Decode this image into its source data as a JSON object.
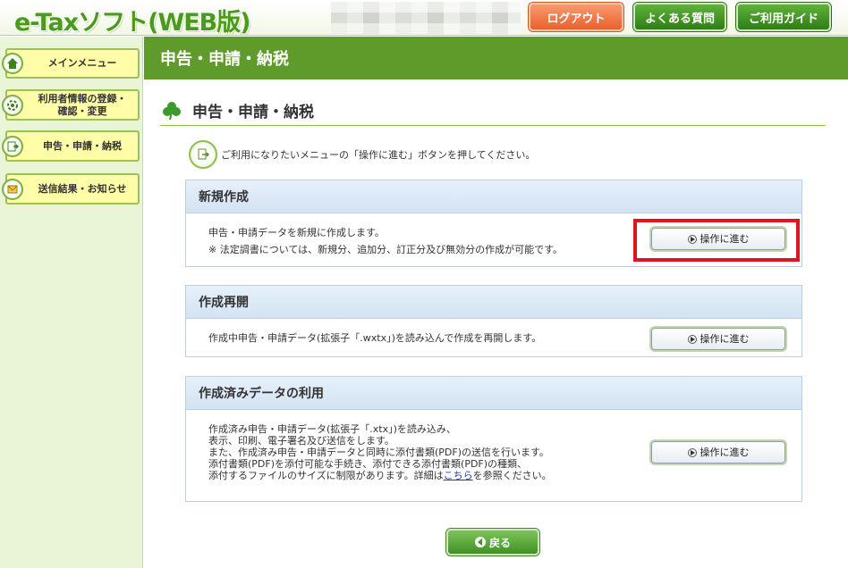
{
  "app": {
    "logo_text": "e-Taxソフト(WEB版)"
  },
  "header": {
    "logout_label": "ログアウト",
    "faq_label": "よくある質問",
    "guide_label": "ご利用ガイド"
  },
  "sidebar": {
    "items": [
      {
        "label": "メインメニュー"
      },
      {
        "label_line1": "利用者情報の登録・",
        "label_line2": "確認・変更"
      },
      {
        "label": "申告・申請・納税"
      },
      {
        "label": "送信結果・お知らせ"
      }
    ]
  },
  "main": {
    "page_title": "申告・申請・納税",
    "section_title": "申告・申請・納税",
    "instruction": "ご利用になりたいメニューの「操作に進む」ボタンを押してください。",
    "panels": [
      {
        "title": "新規作成",
        "lines": [
          "申告・申請データを新規に作成します。",
          "※ 法定調書については、新規分、追加分、訂正分及び無効分の作成が可能です。"
        ],
        "button_label": "操作に進む"
      },
      {
        "title": "作成再開",
        "lines": [
          "作成中申告・申請データ(拡張子「.wxtx」)を読み込んで作成を再開します。"
        ],
        "button_label": "操作に進む"
      },
      {
        "title": "作成済みデータの利用",
        "lines": [
          "作成済み申告・申請データ(拡張子「.xtx」)を読み込み、",
          "表示、印刷、電子署名及び送信をします。",
          "また、作成済み申告・申請データと同時に添付書類(PDF)の送信を行います。",
          "添付書類(PDF)を添付可能な手続き、添付できる添付書類(PDF)の種類、"
        ],
        "last_line_before": "添付するファイルのサイズに制限があります。詳細は",
        "link_text": "こちら",
        "last_line_after": "を参照ください。",
        "button_label": "操作に進む"
      }
    ],
    "back_label": "戻る"
  },
  "colors": {
    "brand_green": "#5f9b2a",
    "logout_orange": "#e9612d",
    "highlight_red": "#e0141e",
    "panel_head_blue": "#d3e3f3",
    "sidebar_yellow": "#fffda8"
  }
}
